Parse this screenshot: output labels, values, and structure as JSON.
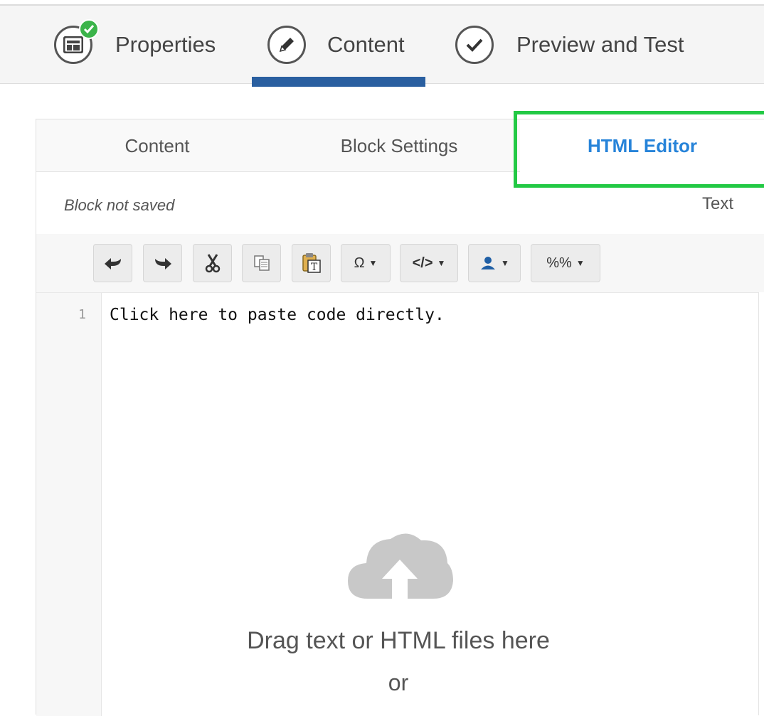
{
  "wizard": {
    "steps": [
      {
        "label": "Properties",
        "icon": "layout-icon",
        "completed": true
      },
      {
        "label": "Content",
        "icon": "pencil-icon",
        "active": true
      },
      {
        "label": "Preview and Test",
        "icon": "check-icon"
      }
    ]
  },
  "tabs": [
    {
      "label": "Content"
    },
    {
      "label": "Block Settings"
    },
    {
      "label": "HTML Editor",
      "active": true
    }
  ],
  "status": {
    "left": "Block not saved",
    "right": "Text"
  },
  "toolbar": {
    "buttons": [
      "undo-icon",
      "redo-icon",
      "cut-icon",
      "copy-icon",
      "paste-text-icon"
    ],
    "dropdowns": [
      {
        "label": "Ω",
        "name": "special-chars-dropdown"
      },
      {
        "label": "</>",
        "name": "code-dropdown"
      },
      {
        "label": "",
        "name": "personalization-dropdown",
        "icon": "user-icon"
      },
      {
        "label": "%%",
        "name": "merge-tags-dropdown"
      }
    ]
  },
  "editor": {
    "line_number": "1",
    "code": "Click here to paste code directly."
  },
  "dropzone": {
    "text": "Drag text or HTML files here",
    "or": "or"
  },
  "colors": {
    "accent": "#2a5fa0",
    "active_tab": "#2683d9",
    "highlight": "#22c944",
    "completed": "#3bb44a"
  }
}
